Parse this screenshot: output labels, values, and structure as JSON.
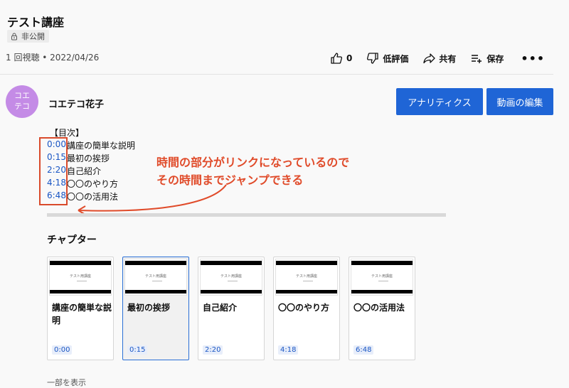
{
  "video": {
    "title": "テスト講座",
    "privacy": "非公開",
    "meta": "1 回視聴 • 2022/04/26"
  },
  "actions": {
    "like_count": "0",
    "dislike_label": "低評価",
    "share_label": "共有",
    "save_label": "保存",
    "more": "•••"
  },
  "channel": {
    "avatar_text_1": "コエ",
    "avatar_text_2": "テコ",
    "avatar_color": "#c48be6",
    "name": "コエテコ花子",
    "analytics_button": "アナリティクス",
    "edit_button": "動画の編集",
    "button_color": "#1f65d6"
  },
  "description": {
    "heading": "【目次】",
    "rows": [
      {
        "time": "0:00",
        "text": "講座の簡単な説明"
      },
      {
        "time": "0:15",
        "text": "最初の挨拶"
      },
      {
        "time": "2:20",
        "text": "自己紹介"
      },
      {
        "time": "4:18",
        "text": "〇〇のやり方"
      },
      {
        "time": "6:48",
        "text": "〇〇の活用法"
      }
    ]
  },
  "annotation": {
    "line1": "時間の部分がリンクになっているので",
    "line2": "その時間までジャンプできる",
    "color": "#e04b2a"
  },
  "chapters": {
    "title": "チャプター",
    "thumb_text": "テスト用講座",
    "items": [
      {
        "label": "講座の簡単な説明",
        "time": "0:00"
      },
      {
        "label": "最初の挨拶",
        "time": "0:15"
      },
      {
        "label": "自己紹介",
        "time": "2:20"
      },
      {
        "label": "〇〇のやり方",
        "time": "4:18"
      },
      {
        "label": "〇〇の活用法",
        "time": "6:48"
      }
    ]
  },
  "show_more": "一部を表示"
}
